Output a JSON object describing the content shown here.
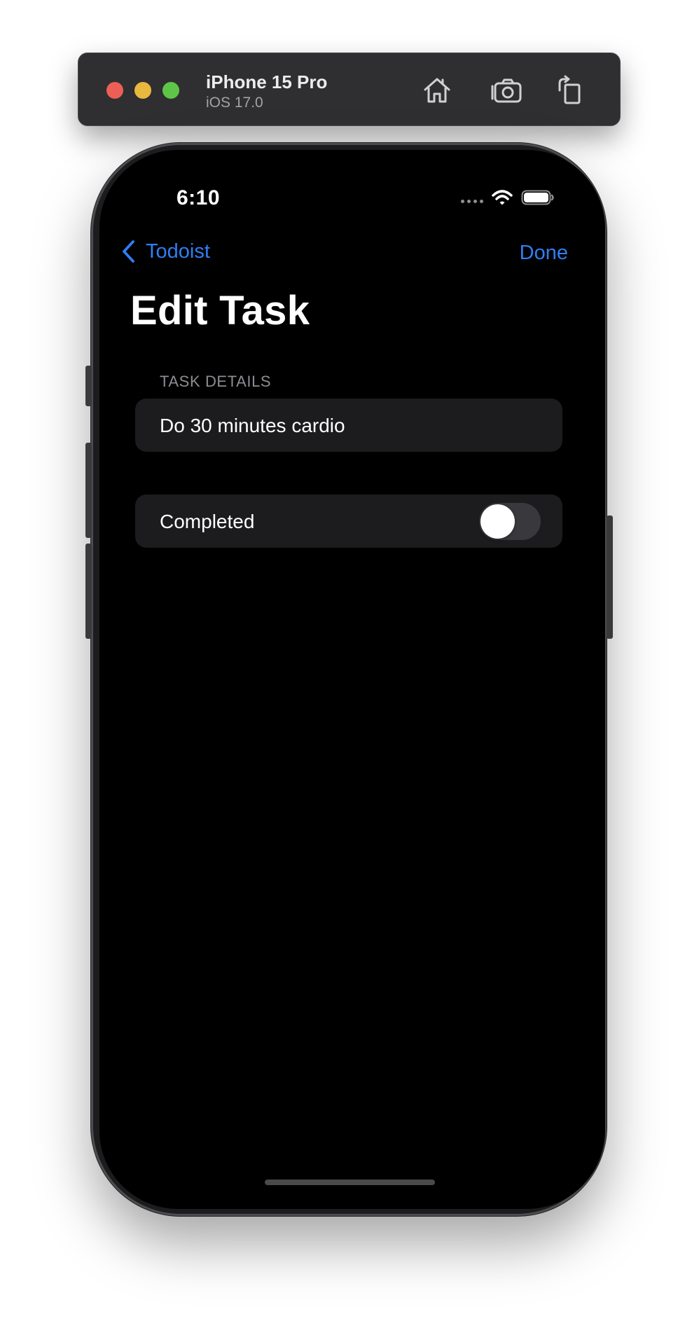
{
  "simulator": {
    "device_name": "iPhone 15 Pro",
    "os_version": "iOS 17.0",
    "buttons": [
      "home-icon",
      "screenshot-icon",
      "rotate-icon"
    ],
    "traffic_lights": {
      "close": "#ec5f57",
      "minimize": "#e8b83f",
      "zoom": "#5fc548"
    }
  },
  "status_bar": {
    "time": "6:10",
    "icons": [
      "cellular-signal-icon",
      "wifi-icon",
      "battery-icon"
    ]
  },
  "nav": {
    "back_label": "Todoist",
    "done_label": "Done",
    "title": "Edit Task",
    "accent_color": "#2f7ef5"
  },
  "form": {
    "section_header": "TASK DETAILS",
    "task_name": "Do 30 minutes cardio",
    "completed_label": "Completed",
    "completed": false
  }
}
